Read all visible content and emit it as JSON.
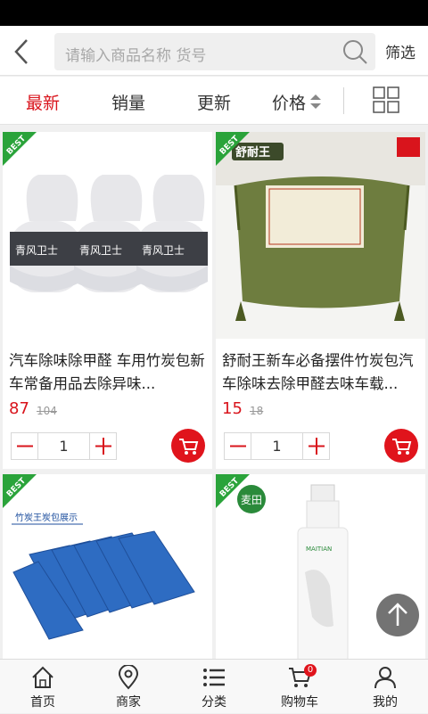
{
  "header": {
    "search_placeholder": "请输入商品名称 货号",
    "filter_label": "筛选"
  },
  "sort_tabs": [
    {
      "label": "最新",
      "active": true
    },
    {
      "label": "销量",
      "active": false
    },
    {
      "label": "更新",
      "active": false
    },
    {
      "label": "价格",
      "active": false
    }
  ],
  "products": [
    {
      "badge": "BEST",
      "title": "汽车除味除甲醛 车用竹炭包新车常备用品去除异味...",
      "price": "87",
      "old_price": "104",
      "quantity": "1",
      "image_brand": "青风卫士"
    },
    {
      "badge": "BEST",
      "title": "舒耐王新车必备摆件竹炭包汽车除味去除甲醛去味车载...",
      "price": "15",
      "old_price": "18",
      "quantity": "1",
      "image_brand": "舒耐王"
    },
    {
      "badge": "BEST",
      "title": "",
      "image_caption": "竹炭王炭包展示"
    },
    {
      "badge": "BEST",
      "title": "",
      "image_brand": "麦田",
      "image_subtext": "MAITIAN"
    }
  ],
  "tabbar": {
    "items": [
      {
        "label": "首页",
        "icon": "home-icon"
      },
      {
        "label": "商家",
        "icon": "location-pin-icon"
      },
      {
        "label": "分类",
        "icon": "list-icon"
      },
      {
        "label": "购物车",
        "icon": "cart-icon",
        "badge": "0"
      },
      {
        "label": "我的",
        "icon": "user-icon"
      }
    ]
  },
  "colors": {
    "accent": "#d9141c",
    "badge_green": "#2aa33a"
  }
}
